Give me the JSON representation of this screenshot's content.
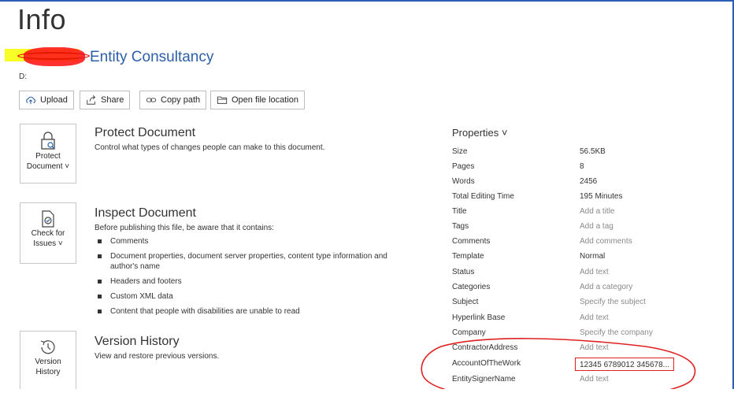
{
  "page": {
    "title": "Info"
  },
  "document": {
    "name": "Entity Consultancy",
    "location": "D:"
  },
  "actions": [
    {
      "label": "Upload",
      "icon": "upload-cloud-icon"
    },
    {
      "label": "Share",
      "icon": "share-icon"
    },
    {
      "label": "Copy path",
      "icon": "link-icon"
    },
    {
      "label": "Open file location",
      "icon": "folder-icon"
    }
  ],
  "protect": {
    "tile_line1": "Protect",
    "tile_line2": "Document ˅",
    "title": "Protect Document",
    "description": "Control what types of changes people can make to this document."
  },
  "inspect": {
    "tile_line1": "Check for",
    "tile_line2": "Issues ˅",
    "title": "Inspect Document",
    "description": "Before publishing this file, be aware that it contains:",
    "items": [
      "Comments",
      "Document properties, document server properties, content type information and author's name",
      "Headers and footers",
      "Custom XML data",
      "Content that people with disabilities are unable to read"
    ]
  },
  "version": {
    "tile_line1": "Version",
    "tile_line2": "History",
    "title": "Version History",
    "description": "View and restore previous versions."
  },
  "properties": {
    "header": "Properties ˅",
    "rows": [
      {
        "label": "Size",
        "value": "56.5KB"
      },
      {
        "label": "Pages",
        "value": "8"
      },
      {
        "label": "Words",
        "value": "2456"
      },
      {
        "label": "Total Editing Time",
        "value": "195 Minutes"
      },
      {
        "label": "Title",
        "value": "Add a title"
      },
      {
        "label": "Tags",
        "value": "Add a tag"
      },
      {
        "label": "Comments",
        "value": "Add comments"
      },
      {
        "label": "Template",
        "value": "Normal"
      },
      {
        "label": "Status",
        "value": "Add text"
      },
      {
        "label": "Categories",
        "value": "Add a category"
      },
      {
        "label": "Subject",
        "value": "Specify the subject"
      },
      {
        "label": "Hyperlink Base",
        "value": "Add text"
      },
      {
        "label": "Company",
        "value": "Specify the company"
      },
      {
        "label": "ContractorAddress",
        "value": "Add text"
      },
      {
        "label": "AccountOfTheWork",
        "value": "12345 6789012 345678..."
      },
      {
        "label": "EntitySignerName",
        "value": "Add text"
      }
    ]
  },
  "colors": {
    "accent": "#2b5fa8",
    "annotation": "#e02020",
    "highlight": "#f6ff00"
  }
}
